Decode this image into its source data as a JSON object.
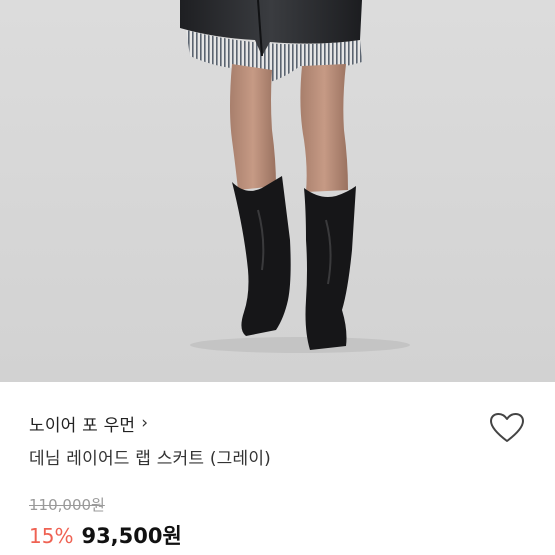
{
  "product": {
    "brand": "노이어 포 우먼",
    "brand_chevron": "›",
    "title": "데님 레이어드 랩 스커트 (그레이)",
    "original_price": "110,000원",
    "discount": "15%",
    "sale_price": "93,500원"
  },
  "icons": {
    "wishlist": "heart-outline-icon",
    "brand_link": "chevron-right-icon"
  },
  "colors": {
    "discount": "#ef6253",
    "photo_background": "#d6d6d6"
  }
}
